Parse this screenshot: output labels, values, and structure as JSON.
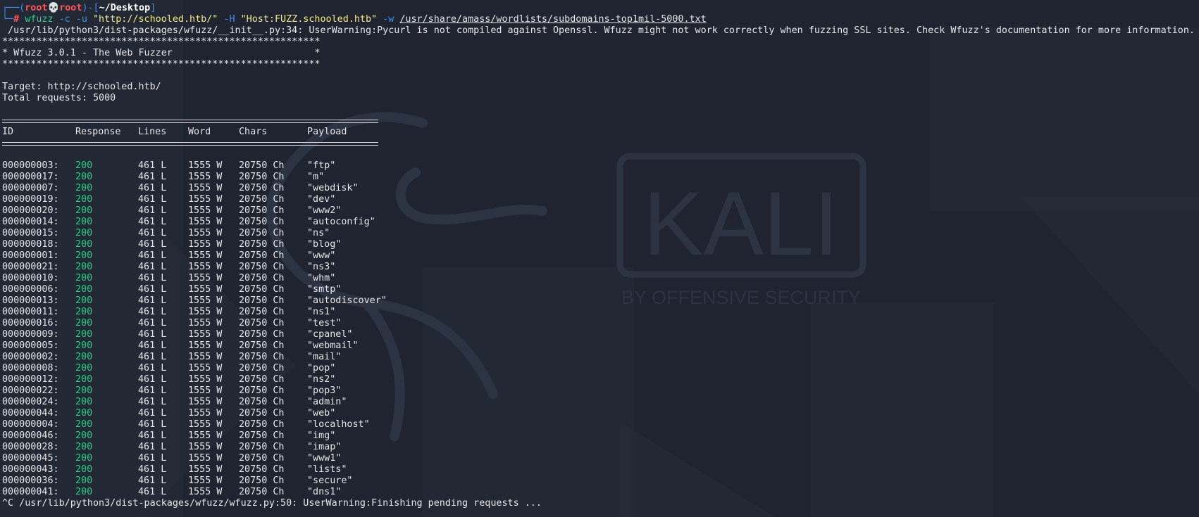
{
  "prompt": {
    "line1_open": "┌──(",
    "user": "root",
    "skull": "💀",
    "host": "root",
    "mid": ")-[",
    "cwd": "~/Desktop",
    "close": "]",
    "line2_start": "└─",
    "hash": "#",
    "command_bin": " wfuzz",
    "flag_c": " -c",
    "flag_u": " -u",
    "url": " \"http://schooled.htb/\"",
    "flag_h": " -H",
    "header": " \"Host:FUZZ.schooled.htb\"",
    "flag_w": " -w ",
    "wordlist": "/usr/share/amass/wordlists/subdomains-top1mil-5000.txt"
  },
  "warning_line": " /usr/lib/python3/dist-packages/wfuzz/__init__.py:34: UserWarning:Pycurl is not compiled against Openssl. Wfuzz might not work correctly when fuzzing SSL sites. Check Wfuzz's documentation for more information.",
  "banner": {
    "stars": "********************************************************",
    "title": "* Wfuzz 3.0.1 - The Web Fuzzer                         *"
  },
  "target_line": "Target: http://schooled.htb/",
  "total_line": "Total requests: 5000",
  "headers": [
    "ID",
    "Response",
    "Lines",
    "Word",
    "Chars",
    "Payload"
  ],
  "results": [
    [
      "000000003:",
      "200",
      "461 L",
      "1555 W",
      "20750 Ch",
      "\"ftp\""
    ],
    [
      "000000017:",
      "200",
      "461 L",
      "1555 W",
      "20750 Ch",
      "\"m\""
    ],
    [
      "000000007:",
      "200",
      "461 L",
      "1555 W",
      "20750 Ch",
      "\"webdisk\""
    ],
    [
      "000000019:",
      "200",
      "461 L",
      "1555 W",
      "20750 Ch",
      "\"dev\""
    ],
    [
      "000000020:",
      "200",
      "461 L",
      "1555 W",
      "20750 Ch",
      "\"www2\""
    ],
    [
      "000000014:",
      "200",
      "461 L",
      "1555 W",
      "20750 Ch",
      "\"autoconfig\""
    ],
    [
      "000000015:",
      "200",
      "461 L",
      "1555 W",
      "20750 Ch",
      "\"ns\""
    ],
    [
      "000000018:",
      "200",
      "461 L",
      "1555 W",
      "20750 Ch",
      "\"blog\""
    ],
    [
      "000000001:",
      "200",
      "461 L",
      "1555 W",
      "20750 Ch",
      "\"www\""
    ],
    [
      "000000021:",
      "200",
      "461 L",
      "1555 W",
      "20750 Ch",
      "\"ns3\""
    ],
    [
      "000000010:",
      "200",
      "461 L",
      "1555 W",
      "20750 Ch",
      "\"whm\""
    ],
    [
      "000000006:",
      "200",
      "461 L",
      "1555 W",
      "20750 Ch",
      "\"smtp\""
    ],
    [
      "000000013:",
      "200",
      "461 L",
      "1555 W",
      "20750 Ch",
      "\"autodiscover\""
    ],
    [
      "000000011:",
      "200",
      "461 L",
      "1555 W",
      "20750 Ch",
      "\"ns1\""
    ],
    [
      "000000016:",
      "200",
      "461 L",
      "1555 W",
      "20750 Ch",
      "\"test\""
    ],
    [
      "000000009:",
      "200",
      "461 L",
      "1555 W",
      "20750 Ch",
      "\"cpanel\""
    ],
    [
      "000000005:",
      "200",
      "461 L",
      "1555 W",
      "20750 Ch",
      "\"webmail\""
    ],
    [
      "000000002:",
      "200",
      "461 L",
      "1555 W",
      "20750 Ch",
      "\"mail\""
    ],
    [
      "000000008:",
      "200",
      "461 L",
      "1555 W",
      "20750 Ch",
      "\"pop\""
    ],
    [
      "000000012:",
      "200",
      "461 L",
      "1555 W",
      "20750 Ch",
      "\"ns2\""
    ],
    [
      "000000022:",
      "200",
      "461 L",
      "1555 W",
      "20750 Ch",
      "\"pop3\""
    ],
    [
      "000000024:",
      "200",
      "461 L",
      "1555 W",
      "20750 Ch",
      "\"admin\""
    ],
    [
      "000000044:",
      "200",
      "461 L",
      "1555 W",
      "20750 Ch",
      "\"web\""
    ],
    [
      "000000004:",
      "200",
      "461 L",
      "1555 W",
      "20750 Ch",
      "\"localhost\""
    ],
    [
      "000000046:",
      "200",
      "461 L",
      "1555 W",
      "20750 Ch",
      "\"img\""
    ],
    [
      "000000028:",
      "200",
      "461 L",
      "1555 W",
      "20750 Ch",
      "\"imap\""
    ],
    [
      "000000045:",
      "200",
      "461 L",
      "1555 W",
      "20750 Ch",
      "\"www1\""
    ],
    [
      "000000043:",
      "200",
      "461 L",
      "1555 W",
      "20750 Ch",
      "\"lists\""
    ],
    [
      "000000036:",
      "200",
      "461 L",
      "1555 W",
      "20750 Ch",
      "\"secure\""
    ],
    [
      "000000041:",
      "200",
      "461 L",
      "1555 W",
      "20750 Ch",
      "\"dns1\""
    ]
  ],
  "final_line": "^C /usr/lib/python3/dist-packages/wfuzz/wfuzz.py:50: UserWarning:Finishing pending requests ...",
  "wallpaper": {
    "logo_text": "KALI",
    "logo_subtitle": "BY OFFENSIVE SECURITY",
    "icon_name": "kali-dragon-icon"
  }
}
